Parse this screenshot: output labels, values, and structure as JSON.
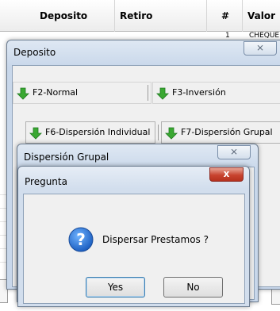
{
  "grid": {
    "headers": [
      "Deposito",
      "Retiro",
      "#",
      "Valor"
    ],
    "cell_num": "1",
    "cell_value": "CHEQUE"
  },
  "deposito_window": {
    "title": "Deposito",
    "close_glyph": "⨯",
    "buttons": {
      "f2": "F2-Normal",
      "f3": "F3-Inversión",
      "f6": "F6-Dispersión Individual",
      "f7": "F7-Dispersión Grupal"
    }
  },
  "dispersion_window": {
    "title": "Dispersión Grupal",
    "close_glyph": "⨯"
  },
  "pregunta_dialog": {
    "title": "Pregunta",
    "close_glyph": "x",
    "message": "Dispersar Prestamos ?",
    "yes_label": "Yes",
    "no_label": "No"
  },
  "colors": {
    "arrow_green": "#3aa832",
    "question_blue": "#1c5fc1",
    "close_red": "#c8432f"
  }
}
